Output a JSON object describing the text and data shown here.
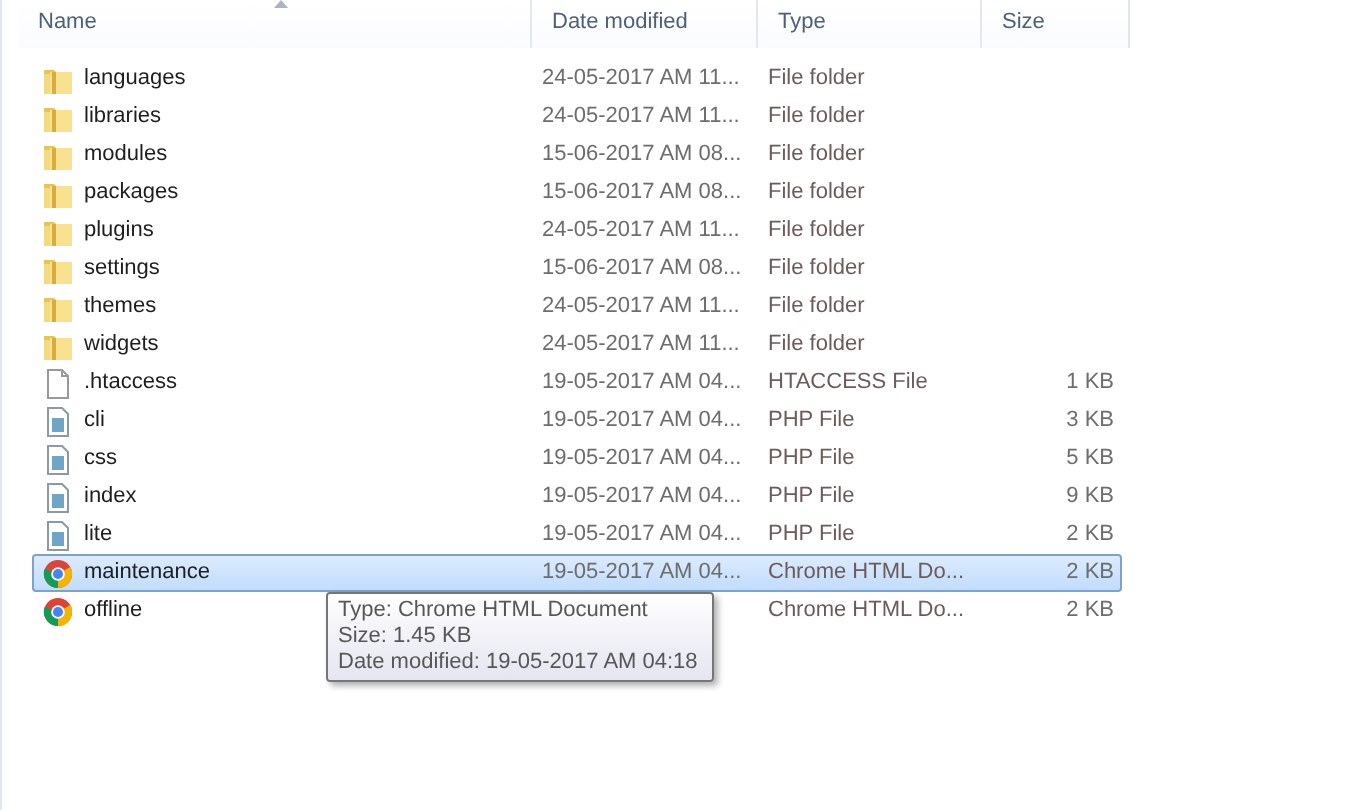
{
  "columns": [
    {
      "label": "Name",
      "sorted": true
    },
    {
      "label": "Date modified",
      "sorted": false
    },
    {
      "label": "Type",
      "sorted": false
    },
    {
      "label": "Size",
      "sorted": false
    }
  ],
  "rows": [
    {
      "kind": "folder",
      "name": "languages",
      "date": "24-05-2017 AM 11...",
      "type": "File folder",
      "selected": false
    },
    {
      "kind": "folder",
      "name": "libraries",
      "date": "24-05-2017 AM 11...",
      "type": "File folder",
      "selected": false
    },
    {
      "kind": "folder",
      "name": "modules",
      "date": "15-06-2017 AM 08...",
      "type": "File folder",
      "selected": false
    },
    {
      "kind": "folder",
      "name": "packages",
      "date": "15-06-2017 AM 08...",
      "type": "File folder",
      "selected": false
    },
    {
      "kind": "folder",
      "name": "plugins",
      "date": "24-05-2017 AM 11...",
      "type": "File folder",
      "selected": false
    },
    {
      "kind": "folder",
      "name": "settings",
      "date": "15-06-2017 AM 08...",
      "type": "File folder",
      "selected": false
    },
    {
      "kind": "folder",
      "name": "themes",
      "date": "24-05-2017 AM 11...",
      "type": "File folder",
      "selected": false
    },
    {
      "kind": "folder",
      "name": "widgets",
      "date": "24-05-2017 AM 11...",
      "type": "File folder",
      "selected": false
    },
    {
      "kind": "file",
      "name": ".htaccess",
      "date": "19-05-2017 AM 04...",
      "type": "HTACCESS File",
      "size": "1 KB",
      "selected": false
    },
    {
      "kind": "php",
      "name": "cli",
      "date": "19-05-2017 AM 04...",
      "type": "PHP File",
      "size": "3 KB",
      "selected": false
    },
    {
      "kind": "php",
      "name": "css",
      "date": "19-05-2017 AM 04...",
      "type": "PHP File",
      "size": "5 KB",
      "selected": false
    },
    {
      "kind": "php",
      "name": "index",
      "date": "19-05-2017 AM 04...",
      "type": "PHP File",
      "size": "9 KB",
      "selected": false
    },
    {
      "kind": "php",
      "name": "lite",
      "date": "19-05-2017 AM 04...",
      "type": "PHP File",
      "size": "2 KB",
      "selected": false
    },
    {
      "kind": "chrome",
      "name": "maintenance",
      "date": "19-05-2017 AM 04...",
      "type": "Chrome HTML Do...",
      "size": "2 KB",
      "selected": true
    },
    {
      "kind": "chrome",
      "name": "offline",
      "type": "Chrome HTML Do...",
      "size": "2 KB",
      "selected": false
    }
  ],
  "tooltip": {
    "lines": [
      "Type: Chrome HTML Document",
      "Size: 1.45 KB",
      "Date modified: 19-05-2017 AM 04:18"
    ]
  }
}
